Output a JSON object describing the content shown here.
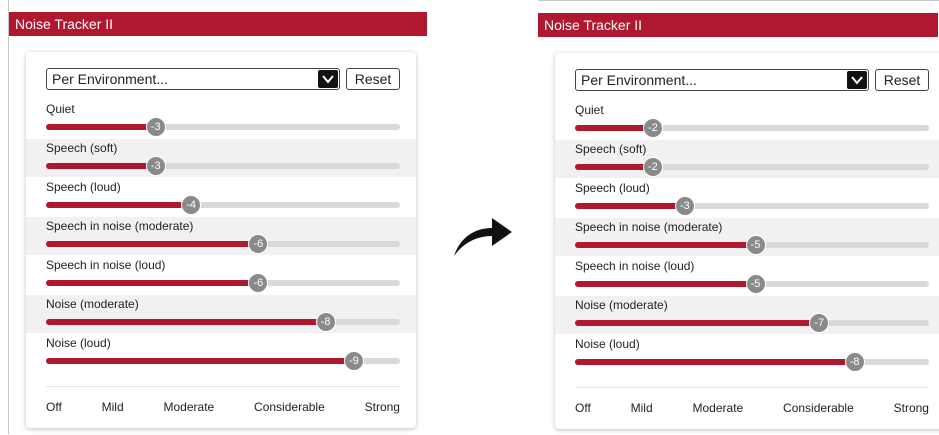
{
  "colors": {
    "accent": "#b0182f",
    "track": "#d9d9d9",
    "thumb": "#8a8a8a"
  },
  "before": {
    "title": "Noise Tracker II",
    "dropdown": {
      "value": "Per Environment...",
      "icon": "chevron-down-icon"
    },
    "reset_label": "Reset",
    "sliders": [
      {
        "label": "Quiet",
        "value": "-3",
        "level": 0.31
      },
      {
        "label": "Speech (soft)",
        "value": "-3",
        "level": 0.31
      },
      {
        "label": "Speech (loud)",
        "value": "-4",
        "level": 0.41
      },
      {
        "label": "Speech in noise (moderate)",
        "value": "-6",
        "level": 0.6
      },
      {
        "label": "Speech in noise (loud)",
        "value": "-6",
        "level": 0.6
      },
      {
        "label": "Noise (moderate)",
        "value": "-8",
        "level": 0.79
      },
      {
        "label": "Noise (loud)",
        "value": "-9",
        "level": 0.87
      }
    ],
    "scale_labels": [
      "Off",
      "Mild",
      "Moderate",
      "Considerable",
      "Strong"
    ]
  },
  "transition_icon": "curved-arrow-right-icon",
  "after": {
    "title": "Noise Tracker II",
    "dropdown": {
      "value": "Per Environment...",
      "icon": "chevron-down-icon"
    },
    "reset_label": "Reset",
    "sliders": [
      {
        "label": "Quiet",
        "value": "-2",
        "level": 0.22
      },
      {
        "label": "Speech (soft)",
        "value": "-2",
        "level": 0.22
      },
      {
        "label": "Speech (loud)",
        "value": "-3",
        "level": 0.31
      },
      {
        "label": "Speech in noise (moderate)",
        "value": "-5",
        "level": 0.51
      },
      {
        "label": "Speech in noise (loud)",
        "value": "-5",
        "level": 0.51
      },
      {
        "label": "Noise (moderate)",
        "value": "-7",
        "level": 0.69
      },
      {
        "label": "Noise (loud)",
        "value": "-8",
        "level": 0.79
      }
    ],
    "scale_labels": [
      "Off",
      "Mild",
      "Moderate",
      "Considerable",
      "Strong"
    ]
  }
}
